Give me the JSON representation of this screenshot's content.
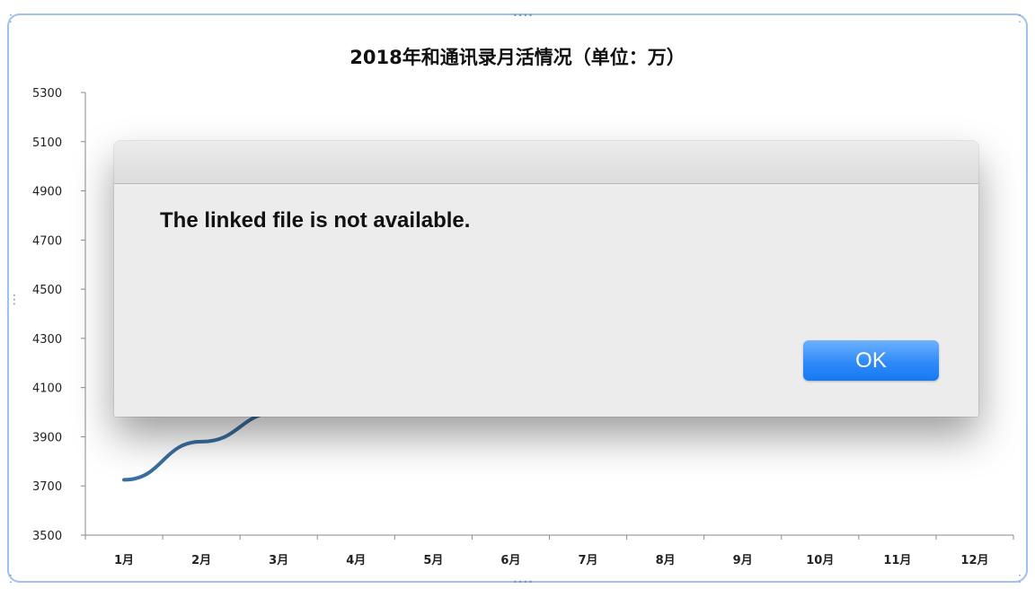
{
  "chart_data": {
    "type": "line",
    "title": "2018年和通讯录月活情况（单位：万）",
    "xlabel": "",
    "ylabel": "",
    "categories": [
      "1月",
      "2月",
      "3月",
      "4月",
      "5月",
      "6月",
      "7月",
      "8月",
      "9月",
      "10月",
      "11月",
      "12月"
    ],
    "yticks": [
      "5300",
      "5100",
      "4900",
      "4700",
      "4500",
      "4300",
      "4100",
      "3900",
      "3700",
      "3500"
    ],
    "ylim": [
      3500,
      5300
    ],
    "series": [
      {
        "values": [
          3725,
          3880,
          4000,
          null,
          null,
          null,
          null,
          null,
          null,
          null,
          null,
          null
        ]
      }
    ],
    "grid": false,
    "line_color": "#3a6f9f"
  },
  "dialog": {
    "message": "The linked file is not available.",
    "ok_label": "OK",
    "button_color": "#2f8af8"
  },
  "handles": {
    "icon": "resize-handle-icon",
    "glyph_horizontal": "••••",
    "glyph_vertical": "⋮",
    "glyph_corner": "⁚"
  }
}
